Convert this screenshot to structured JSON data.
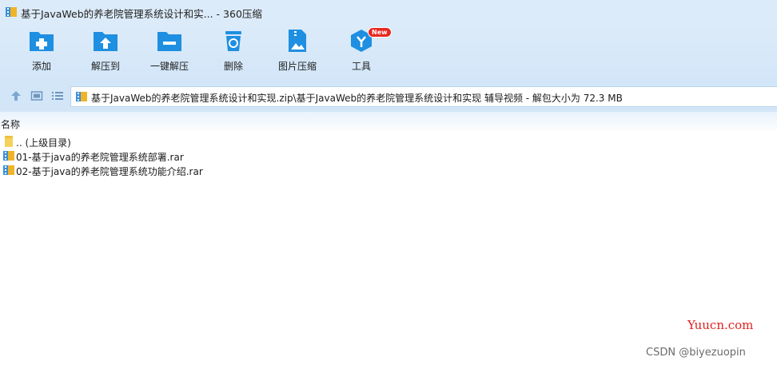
{
  "window": {
    "title": "基于JavaWeb的养老院管理系统设计和实... - 360压缩",
    "app_icon": "archive-app-icon"
  },
  "toolbar": {
    "buttons": [
      {
        "label": "添加",
        "icon": "add-icon"
      },
      {
        "label": "解压到",
        "icon": "extract-to-icon"
      },
      {
        "label": "一键解压",
        "icon": "one-click-extract-icon"
      },
      {
        "label": "删除",
        "icon": "delete-icon"
      },
      {
        "label": "图片压缩",
        "icon": "image-compress-icon"
      },
      {
        "label": "工具",
        "icon": "tools-icon",
        "badge": "New"
      }
    ]
  },
  "address": {
    "path": "基于JavaWeb的养老院管理系统设计和实现.zip\\基于JavaWeb的养老院管理系统设计和实现 辅导视频 - 解包大小为 72.3 MB"
  },
  "list": {
    "column_name": "名称",
    "rows": [
      {
        "name": ".. (上级目录)",
        "icon": "folder-up-icon"
      },
      {
        "name": "01-基于java的养老院管理系统部署.rar",
        "icon": "rar-file-icon"
      },
      {
        "name": "02-基于java的养老院管理系统功能介绍.rar",
        "icon": "rar-file-icon"
      }
    ]
  },
  "watermarks": {
    "site": "Yuucn.com",
    "author": "CSDN @biyezuopin"
  },
  "colors": {
    "toolbar_bg": "#d3e6f8",
    "icon_blue": "#1e8fe1",
    "badge_red": "#e8281f"
  }
}
